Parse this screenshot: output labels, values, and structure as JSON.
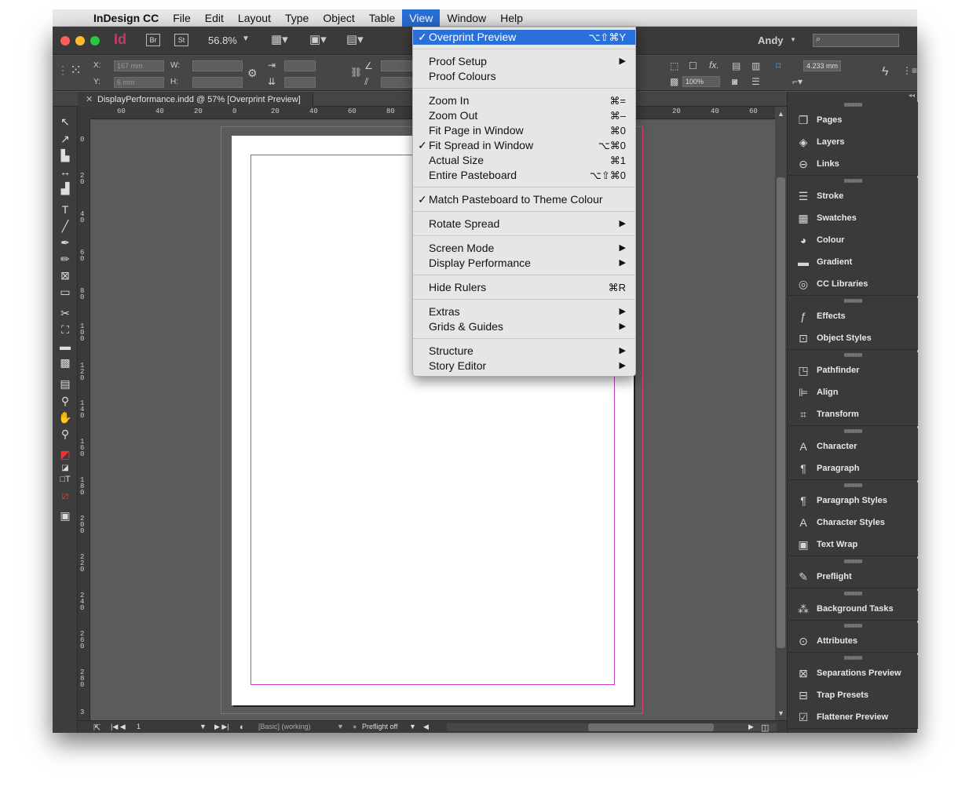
{
  "menubar": {
    "app_name": "InDesign CC",
    "menus": [
      "File",
      "Edit",
      "Layout",
      "Type",
      "Object",
      "Table",
      "View",
      "Window",
      "Help"
    ]
  },
  "appbar": {
    "logo": "Id",
    "bridge": "Br",
    "stock": "St",
    "zoom": "56.8%",
    "user": "Andy"
  },
  "control": {
    "x_label": "X:",
    "y_label": "Y:",
    "w_label": "W:",
    "h_label": "H:",
    "x_value": "167 mm",
    "y_value": "6 mm",
    "stroke_weight": "4.233 mm",
    "opacity": "100%"
  },
  "document": {
    "tab_title": "DisplayPerformance.indd @ 57% [Overprint Preview]"
  },
  "ruler": {
    "h_labels": [
      "60",
      "40",
      "20",
      "0",
      "20",
      "40",
      "60",
      "80",
      "20",
      "40",
      "60"
    ],
    "v_labels": [
      "0",
      "20",
      "40",
      "60",
      "80",
      "100",
      "120",
      "140",
      "160",
      "180",
      "200",
      "220",
      "240",
      "260",
      "280",
      "3"
    ]
  },
  "status": {
    "page": "1",
    "style": "[Basic] (working)",
    "preflight": "Preflight off"
  },
  "panels": {
    "groups": [
      [
        {
          "label": "Pages",
          "icon": "pages-icon",
          "glyph": "❐"
        },
        {
          "label": "Layers",
          "icon": "layers-icon",
          "glyph": "◈"
        },
        {
          "label": "Links",
          "icon": "links-icon",
          "glyph": "⊖"
        }
      ],
      [
        {
          "label": "Stroke",
          "icon": "stroke-icon",
          "glyph": "☰"
        },
        {
          "label": "Swatches",
          "icon": "swatches-icon",
          "glyph": "▦"
        },
        {
          "label": "Colour",
          "icon": "colour-icon",
          "glyph": "◕"
        },
        {
          "label": "Gradient",
          "icon": "gradient-icon",
          "glyph": "▬"
        },
        {
          "label": "CC Libraries",
          "icon": "cc-libraries-icon",
          "glyph": "◎"
        }
      ],
      [
        {
          "label": "Effects",
          "icon": "effects-icon",
          "glyph": "ƒ"
        },
        {
          "label": "Object Styles",
          "icon": "object-styles-icon",
          "glyph": "⊡"
        }
      ],
      [
        {
          "label": "Pathfinder",
          "icon": "pathfinder-icon",
          "glyph": "◳"
        },
        {
          "label": "Align",
          "icon": "align-icon",
          "glyph": "⊫"
        },
        {
          "label": "Transform",
          "icon": "transform-icon",
          "glyph": "⌗"
        }
      ],
      [
        {
          "label": "Character",
          "icon": "character-icon",
          "glyph": "A"
        },
        {
          "label": "Paragraph",
          "icon": "paragraph-icon",
          "glyph": "¶"
        }
      ],
      [
        {
          "label": "Paragraph Styles",
          "icon": "paragraph-styles-icon",
          "glyph": "¶"
        },
        {
          "label": "Character Styles",
          "icon": "character-styles-icon",
          "glyph": "A"
        },
        {
          "label": "Text Wrap",
          "icon": "text-wrap-icon",
          "glyph": "▣"
        }
      ],
      [
        {
          "label": "Preflight",
          "icon": "preflight-icon",
          "glyph": "✎"
        }
      ],
      [
        {
          "label": "Background Tasks",
          "icon": "background-tasks-icon",
          "glyph": "⁂"
        }
      ],
      [
        {
          "label": "Attributes",
          "icon": "attributes-icon",
          "glyph": "⊙"
        }
      ],
      [
        {
          "label": "Separations Preview",
          "icon": "separations-preview-icon",
          "glyph": "⊠"
        },
        {
          "label": "Trap Presets",
          "icon": "trap-presets-icon",
          "glyph": "⊟"
        },
        {
          "label": "Flattener Preview",
          "icon": "flattener-preview-icon",
          "glyph": "☑"
        }
      ]
    ]
  },
  "view_menu": {
    "items": [
      {
        "type": "item",
        "label": "Overprint Preview",
        "check": "✓",
        "shortcut": "⌥⇧⌘Y",
        "highlight": true
      },
      {
        "type": "sep"
      },
      {
        "type": "item",
        "label": "Proof Setup",
        "submenu": true
      },
      {
        "type": "item",
        "label": "Proof Colours"
      },
      {
        "type": "sep"
      },
      {
        "type": "item",
        "label": "Zoom In",
        "shortcut": "⌘="
      },
      {
        "type": "item",
        "label": "Zoom Out",
        "shortcut": "⌘–"
      },
      {
        "type": "item",
        "label": "Fit Page in Window",
        "shortcut": "⌘0"
      },
      {
        "type": "item",
        "label": "Fit Spread in Window",
        "check": "✓",
        "shortcut": "⌥⌘0"
      },
      {
        "type": "item",
        "label": "Actual Size",
        "shortcut": "⌘1"
      },
      {
        "type": "item",
        "label": "Entire Pasteboard",
        "shortcut": "⌥⇧⌘0"
      },
      {
        "type": "sep"
      },
      {
        "type": "item",
        "label": "Match Pasteboard to Theme Colour",
        "check": "✓"
      },
      {
        "type": "sep"
      },
      {
        "type": "item",
        "label": "Rotate Spread",
        "submenu": true
      },
      {
        "type": "sep"
      },
      {
        "type": "item",
        "label": "Screen Mode",
        "submenu": true
      },
      {
        "type": "item",
        "label": "Display Performance",
        "submenu": true
      },
      {
        "type": "sep"
      },
      {
        "type": "item",
        "label": "Hide Rulers",
        "shortcut": "⌘R"
      },
      {
        "type": "sep"
      },
      {
        "type": "item",
        "label": "Extras",
        "submenu": true
      },
      {
        "type": "item",
        "label": "Grids & Guides",
        "submenu": true
      },
      {
        "type": "sep"
      },
      {
        "type": "item",
        "label": "Structure",
        "submenu": true
      },
      {
        "type": "item",
        "label": "Story Editor",
        "submenu": true
      }
    ]
  }
}
